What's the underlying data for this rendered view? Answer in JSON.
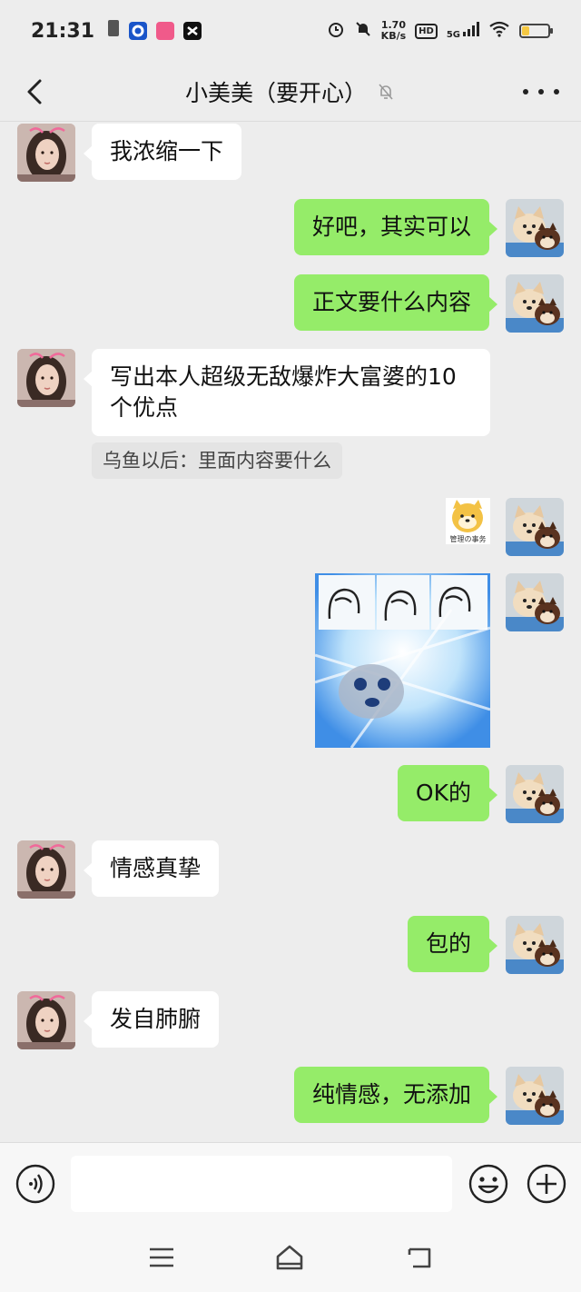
{
  "status_bar": {
    "time": "21:31",
    "net_speed_value": "1.70",
    "net_speed_unit": "KB/s",
    "hd_badge": "HD",
    "signal_label": "5G",
    "battery_level": 0.3,
    "colors": {
      "battery": "#f5c842"
    }
  },
  "header": {
    "title": "小美美（要开心）",
    "back_icon": "chevron-left-icon",
    "mute_icon": "bell-muted-icon",
    "more_icon": "more-dots-icon"
  },
  "messages": [
    {
      "side": "left",
      "type": "text",
      "text": "我浓缩一下"
    },
    {
      "side": "right",
      "type": "text",
      "text": "好吧，其实可以"
    },
    {
      "side": "right",
      "type": "text",
      "text": "正文要什么内容"
    },
    {
      "side": "left",
      "type": "text",
      "text": "写出本人超级无敌爆炸大富婆的10个优点"
    },
    {
      "side": "left",
      "type": "quote",
      "text": "乌鱼以后：里面内容要什么"
    },
    {
      "side": "right",
      "type": "sticker",
      "caption": "管理の事务"
    },
    {
      "side": "right",
      "type": "sticker-image"
    },
    {
      "side": "right",
      "type": "text",
      "text": "OK的"
    },
    {
      "side": "left",
      "type": "text",
      "text": "情感真挚"
    },
    {
      "side": "right",
      "type": "text",
      "text": "包的"
    },
    {
      "side": "left",
      "type": "text",
      "text": "发自肺腑"
    },
    {
      "side": "right",
      "type": "text",
      "text": "纯情感，无添加"
    }
  ],
  "input_bar": {
    "voice_icon": "voice-icon",
    "input_value": "",
    "emoji_icon": "emoji-icon",
    "plus_icon": "plus-icon"
  },
  "nav_bar": {
    "menu_icon": "menu-icon",
    "home_icon": "home-icon",
    "back_icon": "back-icon"
  },
  "colors": {
    "background": "#ededed",
    "bubble_self": "#95ec69",
    "bubble_other": "#ffffff",
    "quote_bg": "#e4e4e4"
  }
}
